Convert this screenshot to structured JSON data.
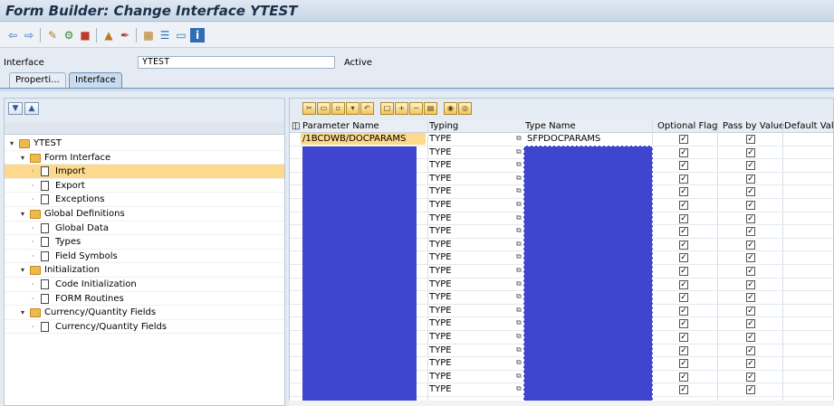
{
  "window": {
    "title": "Form Builder: Change Interface YTEST"
  },
  "toolbar": {
    "icons": [
      "back-icon",
      "forward-icon",
      "display-change-icon",
      "activate-icon",
      "check-icon",
      "other-object-icon",
      "edit-icon",
      "hierarchy-icon",
      "layout-icon",
      "window-icon",
      "info-icon"
    ]
  },
  "header": {
    "interface_label": "Interface",
    "interface_value": "YTEST",
    "status": "Active"
  },
  "tabs": [
    {
      "label": "Properti..."
    },
    {
      "label": "Interface"
    }
  ],
  "tree": {
    "items": [
      {
        "label": "YTEST",
        "level": 0,
        "type": "folder",
        "expanded": true
      },
      {
        "label": "Form Interface",
        "level": 1,
        "type": "folder",
        "expanded": true
      },
      {
        "label": "Import",
        "level": 2,
        "type": "doc",
        "selected": true
      },
      {
        "label": "Export",
        "level": 2,
        "type": "doc"
      },
      {
        "label": "Exceptions",
        "level": 2,
        "type": "doc"
      },
      {
        "label": "Global Definitions",
        "level": 1,
        "type": "folder",
        "expanded": true
      },
      {
        "label": "Global Data",
        "level": 2,
        "type": "doc"
      },
      {
        "label": "Types",
        "level": 2,
        "type": "doc"
      },
      {
        "label": "Field Symbols",
        "level": 2,
        "type": "doc"
      },
      {
        "label": "Initialization",
        "level": 1,
        "type": "folder",
        "expanded": true
      },
      {
        "label": "Code Initialization",
        "level": 2,
        "type": "doc"
      },
      {
        "label": "FORM Routines",
        "level": 2,
        "type": "doc"
      },
      {
        "label": "Currency/Quantity Fields",
        "level": 1,
        "type": "folder",
        "expanded": true
      },
      {
        "label": "Currency/Quantity Fields",
        "level": 2,
        "type": "doc"
      }
    ]
  },
  "table": {
    "columns": [
      "Parameter Name",
      "Typing",
      "Type Name",
      "Optional Flag",
      "Pass by Value",
      "Default Value"
    ],
    "rows": [
      {
        "param": "/1BCDWB/DOCPARAMS",
        "typing": "TYPE",
        "type_name": "SFPDOCPARAMS",
        "optional": true,
        "by_value": true
      },
      {
        "param": "",
        "typing": "TYPE",
        "type_name": "",
        "optional": true,
        "by_value": true
      },
      {
        "param": "",
        "typing": "TYPE",
        "type_name": "",
        "optional": true,
        "by_value": true
      },
      {
        "param": "",
        "typing": "TYPE",
        "type_name": "",
        "optional": true,
        "by_value": true
      },
      {
        "param": "",
        "typing": "TYPE",
        "type_name": "",
        "optional": true,
        "by_value": true
      },
      {
        "param": "",
        "typing": "TYPE",
        "type_name": "",
        "optional": true,
        "by_value": true
      },
      {
        "param": "",
        "typing": "TYPE",
        "type_name": "",
        "optional": true,
        "by_value": true
      },
      {
        "param": "",
        "typing": "TYPE",
        "type_name": "",
        "optional": true,
        "by_value": true
      },
      {
        "param": "",
        "typing": "TYPE",
        "type_name": "",
        "optional": true,
        "by_value": true
      },
      {
        "param": "",
        "typing": "TYPE",
        "type_name": "",
        "optional": true,
        "by_value": true
      },
      {
        "param": "",
        "typing": "TYPE",
        "type_name": "",
        "optional": true,
        "by_value": true
      },
      {
        "param": "",
        "typing": "TYPE",
        "type_name": "",
        "optional": true,
        "by_value": true
      },
      {
        "param": "",
        "typing": "TYPE",
        "type_name": "",
        "optional": true,
        "by_value": true
      },
      {
        "param": "",
        "typing": "TYPE",
        "type_name": "",
        "optional": true,
        "by_value": true
      },
      {
        "param": "",
        "typing": "TYPE",
        "type_name": "",
        "optional": true,
        "by_value": true
      },
      {
        "param": "",
        "typing": "TYPE",
        "type_name": "",
        "optional": true,
        "by_value": true
      },
      {
        "param": "",
        "typing": "TYPE",
        "type_name": "",
        "optional": true,
        "by_value": true
      },
      {
        "param": "",
        "typing": "TYPE",
        "type_name": "",
        "optional": true,
        "by_value": true
      },
      {
        "param": "",
        "typing": "TYPE",
        "type_name": "",
        "optional": true,
        "by_value": true
      },
      {
        "param": "",
        "typing": "TYPE",
        "type_name": "",
        "optional": true,
        "by_value": true
      }
    ]
  },
  "colors": {
    "title": "#1d2f4a",
    "selected": "#fcd98c",
    "redaction": "#3e46cf",
    "folder": "#f0b94c"
  }
}
